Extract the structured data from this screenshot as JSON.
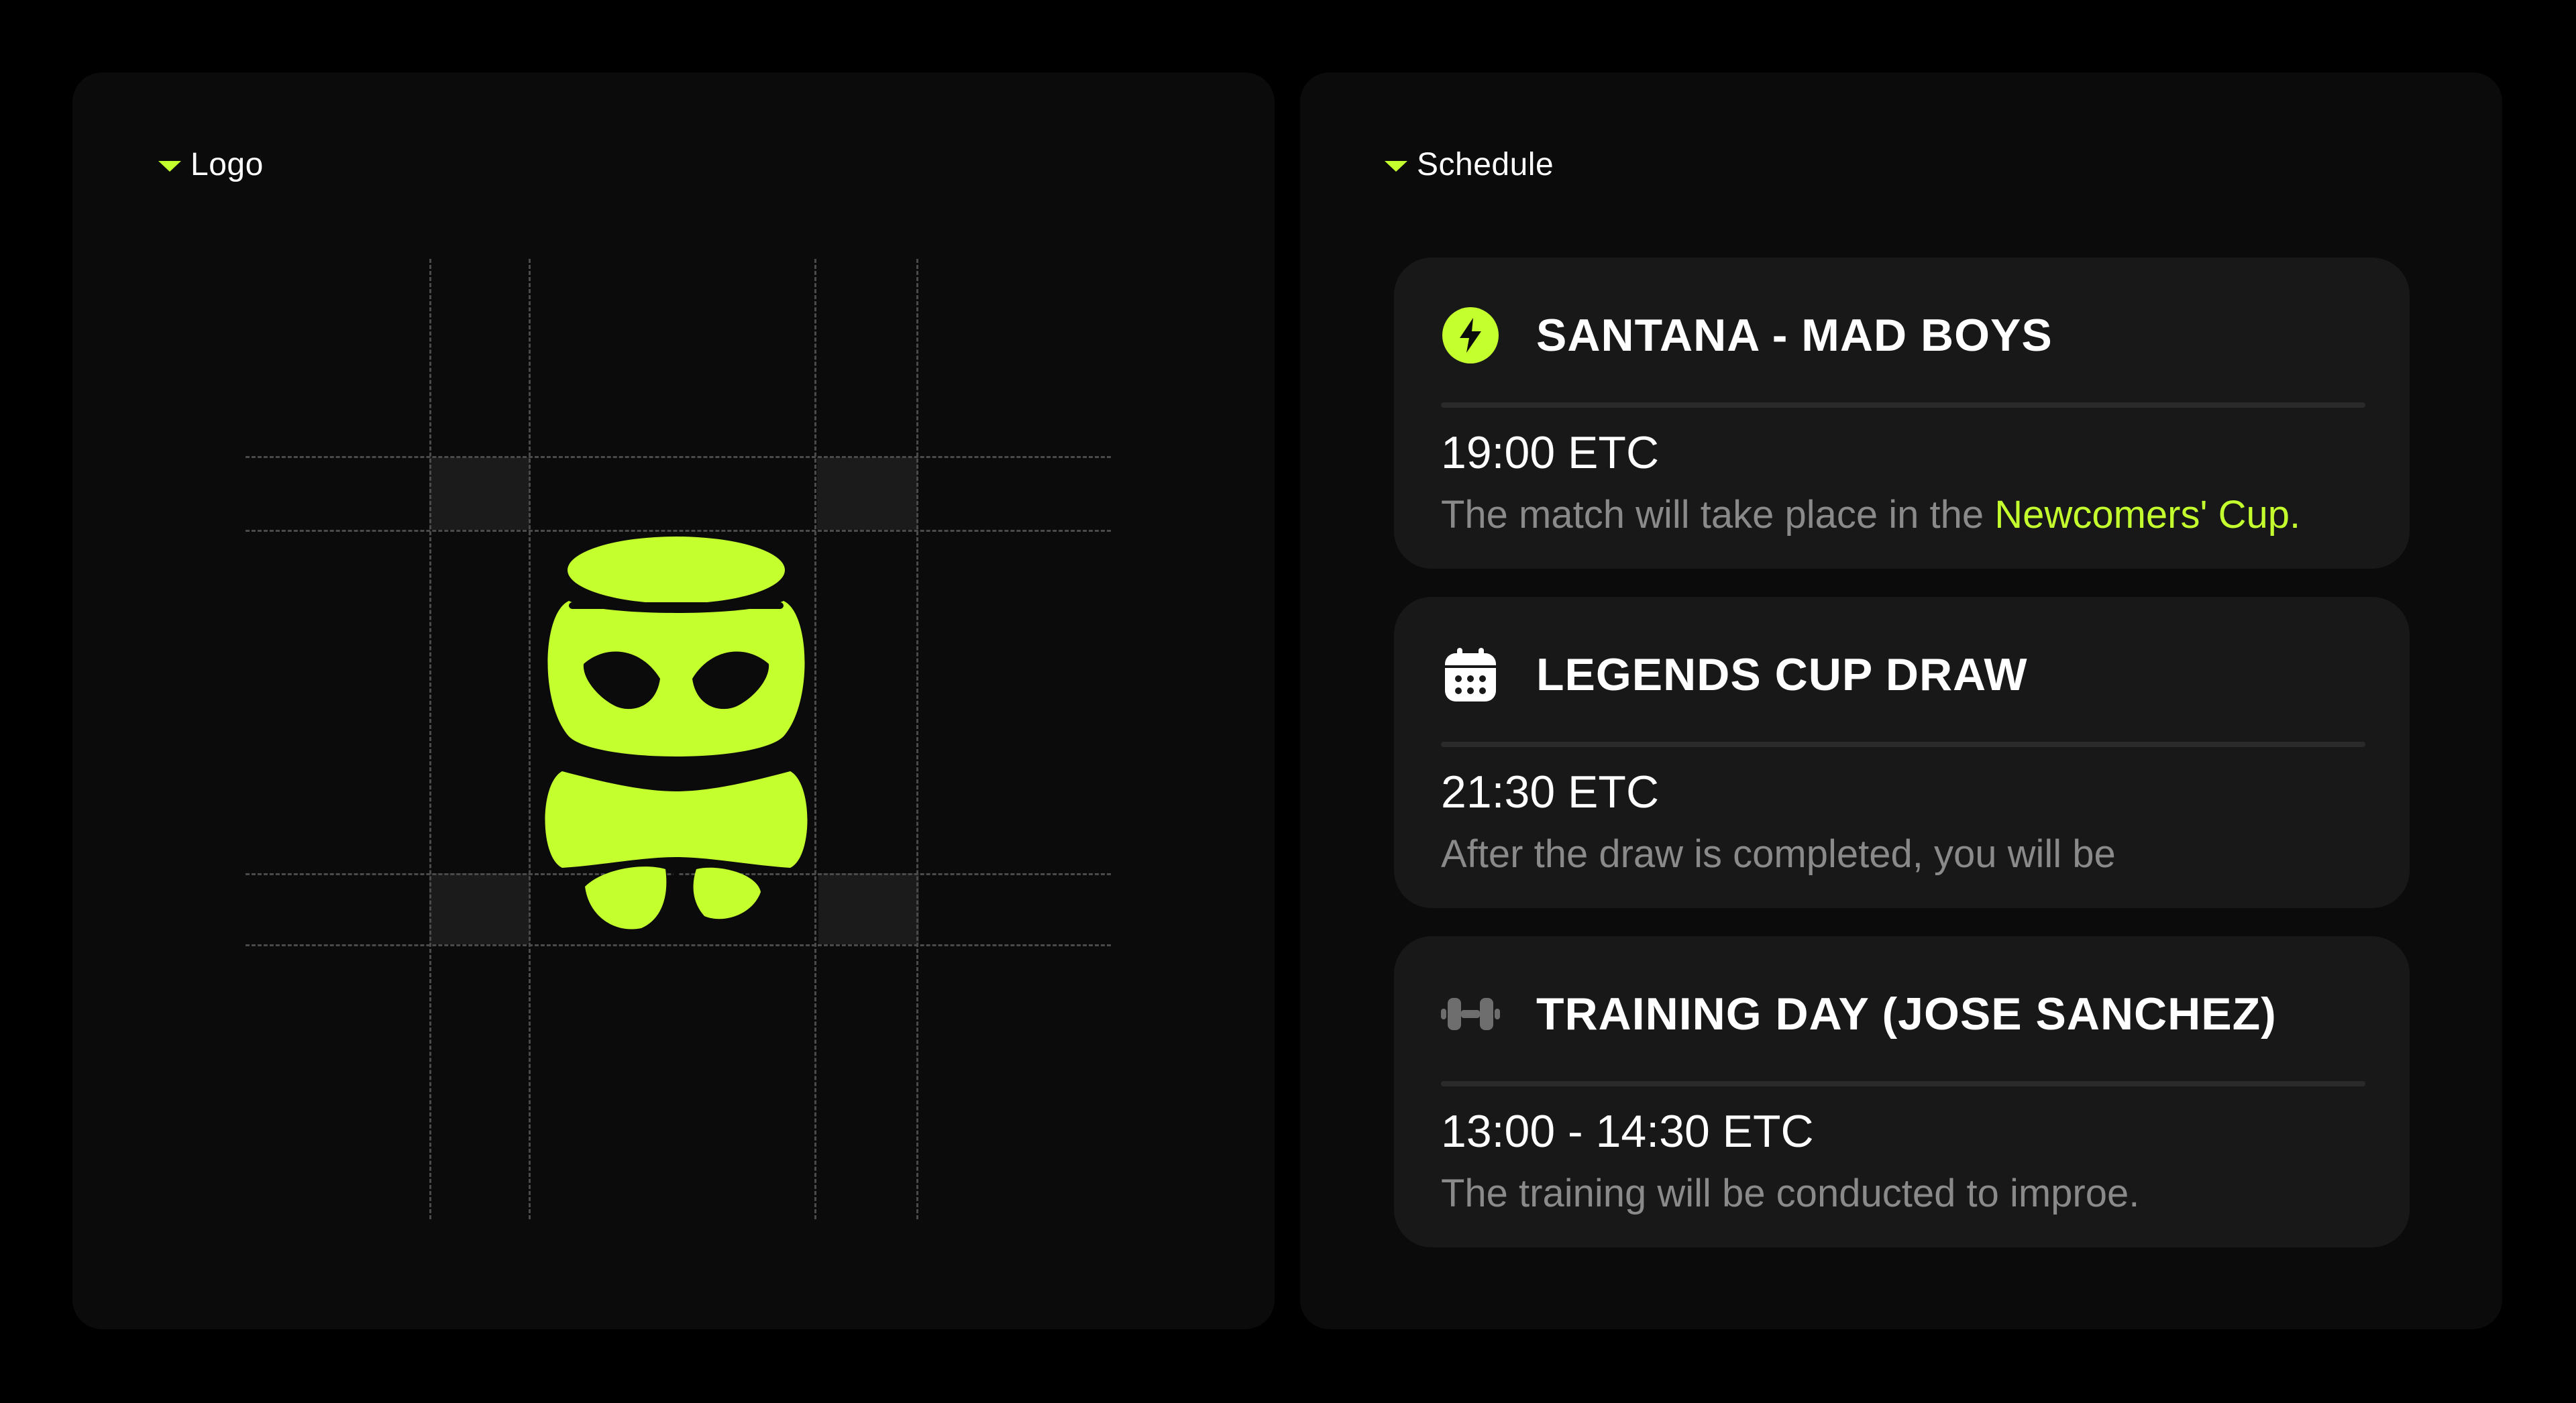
{
  "colors": {
    "background": "#000000",
    "panel": "#0b0b0b",
    "card": "#181818",
    "accent": "#c4ff2e",
    "muted_text": "#8a8a8a"
  },
  "logo_panel": {
    "label": "Logo",
    "caret_icon": "caret-down-icon",
    "mark_icon": "alien-mascot-logo"
  },
  "schedule_panel": {
    "label": "Schedule",
    "caret_icon": "caret-down-icon",
    "events": [
      {
        "icon": "lightning-bolt-icon",
        "title": "SANTANA - MAD BOYS",
        "time": "19:00 ETC",
        "description": "The match will take place in the ",
        "description_highlight": "Newcomers' Cup."
      },
      {
        "icon": "calendar-icon",
        "title": "LEGENDS CUP DRAW",
        "time": "21:30 ETC",
        "description": "After the draw is completed, you will be",
        "description_highlight": ""
      },
      {
        "icon": "dumbbell-icon",
        "title": "TRAINING DAY (JOSE SANCHEZ)",
        "time": "13:00 - 14:30 ETC",
        "description": "The training will be conducted to improe.",
        "description_highlight": ""
      }
    ]
  }
}
